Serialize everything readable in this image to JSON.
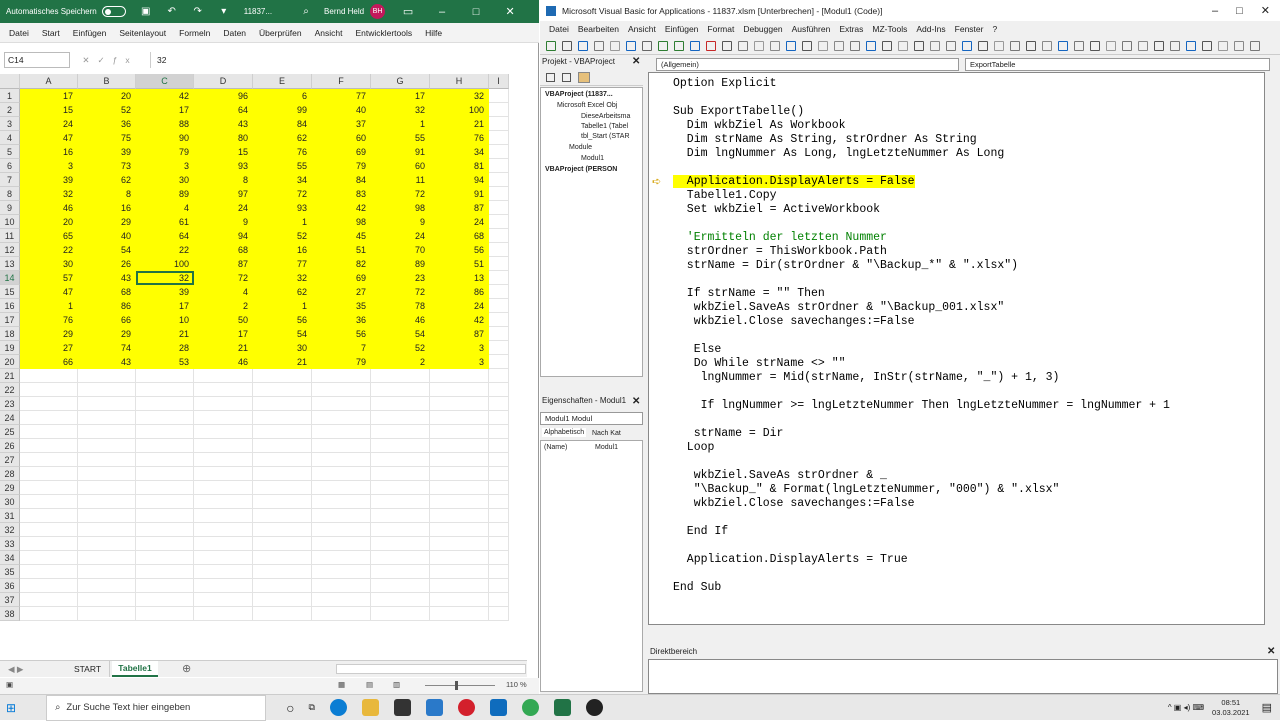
{
  "excel": {
    "autosave_label": "Automatisches Speichern",
    "filename": "11837...",
    "user": "Bernd Held",
    "user_initials": "BH",
    "menu": [
      "Datei",
      "Start",
      "Einfügen",
      "Seitenlayout",
      "Formeln",
      "Daten",
      "Überprüfen",
      "Ansicht",
      "Entwicklertools",
      "Hilfe"
    ],
    "namebox": "C14",
    "formula": "32",
    "columns": [
      "A",
      "B",
      "C",
      "D",
      "E",
      "F",
      "G",
      "H",
      "I"
    ],
    "rows": [
      "1",
      "2",
      "3",
      "4",
      "5",
      "6",
      "7",
      "8",
      "9",
      "10",
      "11",
      "12",
      "13",
      "14",
      "15",
      "16",
      "17",
      "18",
      "19",
      "20",
      "21",
      "22",
      "23",
      "24",
      "25",
      "26",
      "27",
      "28",
      "29",
      "30",
      "31",
      "32",
      "33",
      "34",
      "35",
      "36",
      "37",
      "38"
    ],
    "data": [
      [
        17,
        20,
        42,
        96,
        6,
        77,
        17,
        32
      ],
      [
        15,
        52,
        17,
        64,
        99,
        40,
        32,
        100
      ],
      [
        24,
        36,
        88,
        43,
        84,
        37,
        1,
        21
      ],
      [
        47,
        75,
        90,
        80,
        62,
        60,
        55,
        76
      ],
      [
        16,
        39,
        79,
        15,
        76,
        69,
        91,
        34
      ],
      [
        3,
        73,
        3,
        93,
        55,
        79,
        60,
        81
      ],
      [
        39,
        62,
        30,
        8,
        34,
        84,
        11,
        94
      ],
      [
        32,
        8,
        89,
        97,
        72,
        83,
        72,
        91
      ],
      [
        46,
        16,
        4,
        24,
        93,
        42,
        98,
        87
      ],
      [
        20,
        29,
        61,
        9,
        1,
        98,
        9,
        24
      ],
      [
        65,
        40,
        64,
        94,
        52,
        45,
        24,
        68
      ],
      [
        22,
        54,
        22,
        68,
        16,
        51,
        70,
        56
      ],
      [
        30,
        26,
        100,
        87,
        77,
        82,
        89,
        51
      ],
      [
        57,
        43,
        32,
        72,
        32,
        69,
        23,
        13
      ],
      [
        47,
        68,
        39,
        4,
        62,
        27,
        72,
        86
      ],
      [
        1,
        86,
        17,
        2,
        1,
        35,
        78,
        24
      ],
      [
        76,
        66,
        10,
        50,
        56,
        36,
        46,
        42
      ],
      [
        29,
        29,
        21,
        17,
        54,
        56,
        54,
        87
      ],
      [
        27,
        74,
        28,
        21,
        30,
        7,
        52,
        3
      ],
      [
        66,
        43,
        53,
        46,
        21,
        79,
        2,
        3
      ]
    ],
    "sheet_tabs": [
      "START",
      "Tabelle1"
    ],
    "active_tab": "Tabelle1",
    "zoom": "110 %",
    "highlight_color": "#ffff00"
  },
  "vba": {
    "title": "Microsoft Visual Basic for Applications - 11837.xlsm [Unterbrechen] - [Modul1 (Code)]",
    "menu": [
      "Datei",
      "Bearbeiten",
      "Ansicht",
      "Einfügen",
      "Format",
      "Debuggen",
      "Ausführen",
      "Extras",
      "MZ-Tools",
      "Add-Ins",
      "Fenster",
      "?"
    ],
    "project_header": "Projekt - VBAProject",
    "tree": [
      "VBAProject (11837...",
      "Microsoft Excel Obj",
      "DieseArbeitsma",
      "Tabelle1 (Tabel",
      "tbl_Start (STAR",
      "Module",
      "Modul1",
      "VBAProject (PERSON"
    ],
    "properties_header": "Eigenschaften - Modul1",
    "properties_combo": "Modul1 Modul",
    "properties_tabs": [
      "Alphabetisch",
      "Nach Kat"
    ],
    "property_name": "(Name)",
    "property_value": "Modul1",
    "combo_left": "(Allgemein)",
    "combo_right": "ExportTabelle",
    "direkt_header": "Direktbereich",
    "code": [
      "Option Explicit",
      "",
      "Sub ExportTabelle()",
      "  Dim wkbZiel As Workbook",
      "  Dim strName As String, strOrdner As String",
      "  Dim lngNummer As Long, lngLetzteNummer As Long",
      "",
      "  Application.DisplayAlerts = False",
      "  Tabelle1.Copy",
      "  Set wkbZiel = ActiveWorkbook",
      "",
      "  'Ermitteln der letzten Nummer",
      "  strOrdner = ThisWorkbook.Path",
      "  strName = Dir(strOrdner & \"\\Backup_*\" & \".xlsx\")",
      "",
      "  If strName = \"\" Then",
      "   wkbZiel.SaveAs strOrdner & \"\\Backup_001.xlsx\"",
      "   wkbZiel.Close savechanges:=False",
      "",
      "   Else",
      "   Do While strName <> \"\"",
      "    lngNummer = Mid(strName, InStr(strName, \"_\") + 1, 3)",
      "",
      "    If lngNummer >= lngLetzteNummer Then lngLetzteNummer = lngNummer + 1",
      "",
      "   strName = Dir",
      "  Loop",
      "",
      "   wkbZiel.SaveAs strOrdner & _",
      "   \"\\Backup_\" & Format(lngLetzteNummer, \"000\") & \".xlsx\"",
      "   wkbZiel.Close savechanges:=False",
      "",
      "  End If",
      "",
      "  Application.DisplayAlerts = True",
      "",
      "End Sub"
    ],
    "current_line": 7
  },
  "taskbar": {
    "search_placeholder": "Zur Suche Text hier eingeben",
    "time": "08:51",
    "date": "03.03.2021"
  }
}
